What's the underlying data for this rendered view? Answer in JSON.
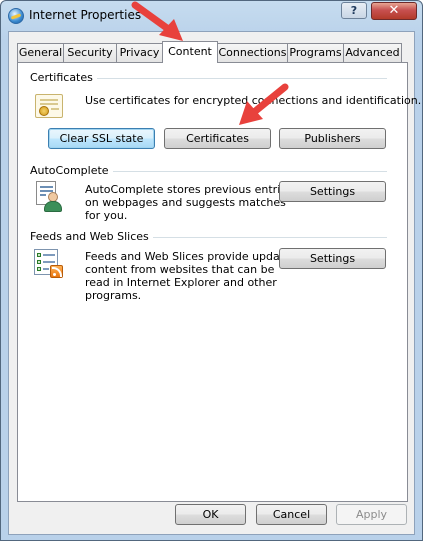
{
  "window": {
    "title": "Internet Properties",
    "help_label": "?",
    "close_label": "✕"
  },
  "tabs": [
    {
      "label": "General"
    },
    {
      "label": "Security"
    },
    {
      "label": "Privacy"
    },
    {
      "label": "Content",
      "active": true
    },
    {
      "label": "Connections"
    },
    {
      "label": "Programs"
    },
    {
      "label": "Advanced"
    }
  ],
  "certificates": {
    "heading": "Certificates",
    "description": "Use certificates for encrypted connections and identification.",
    "icon": "certificate-icon",
    "clear_ssl_label": "Clear SSL state",
    "certificates_label": "Certificates",
    "publishers_label": "Publishers"
  },
  "autocomplete": {
    "heading": "AutoComplete",
    "description_lines": [
      "AutoComplete stores previous entries",
      "on webpages and suggests matches",
      "for you."
    ],
    "icon": "autocomplete-icon",
    "settings_label": "Settings"
  },
  "feeds": {
    "heading": "Feeds and Web Slices",
    "description_lines": [
      "Feeds and Web Slices provide updated",
      "content from websites that can be",
      "read in Internet Explorer and other",
      "programs."
    ],
    "icon": "feeds-icon",
    "settings_label": "Settings"
  },
  "footer": {
    "ok_label": "OK",
    "cancel_label": "Cancel",
    "apply_label": "Apply"
  },
  "colors": {
    "arrow": "#e8413c",
    "focus_border": "#3c7fb1"
  }
}
